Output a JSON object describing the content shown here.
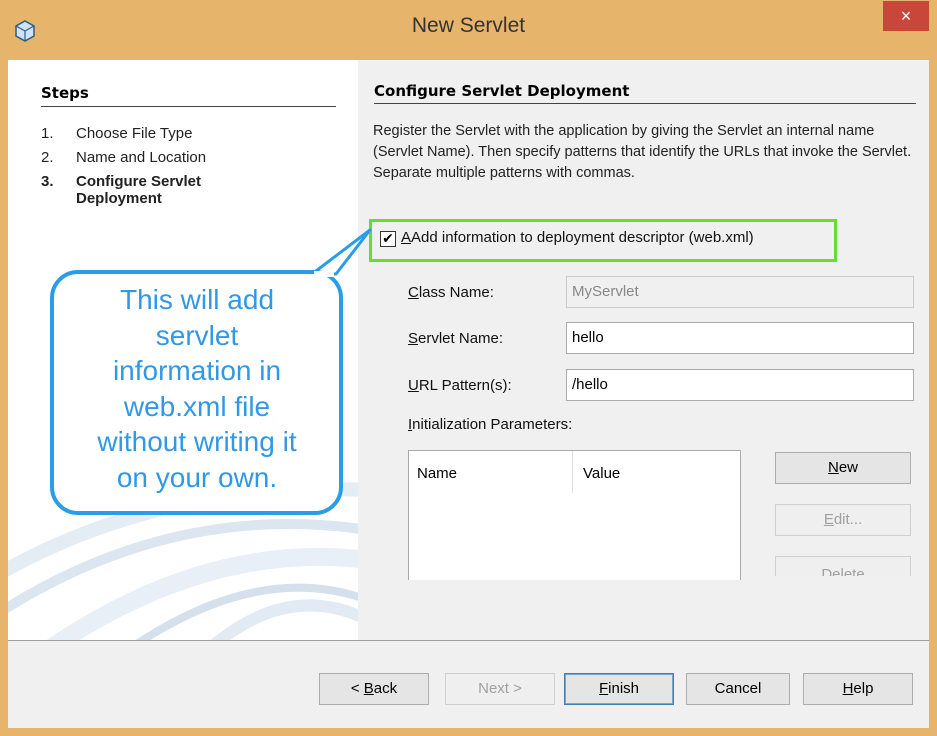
{
  "window": {
    "title": "New Servlet",
    "close_label": "×"
  },
  "steps": {
    "title": "Steps",
    "items": [
      {
        "num": "1.",
        "label": "Choose File Type"
      },
      {
        "num": "2.",
        "label": "Name and Location"
      },
      {
        "num": "3.",
        "label_line1": "Configure Servlet",
        "label_line2": "Deployment"
      }
    ]
  },
  "panel": {
    "title": "Configure Servlet Deployment",
    "description": "Register the Servlet with the application by giving the Servlet an internal name (Servlet Name). Then specify patterns that identify the URLs that invoke the Servlet. Separate multiple patterns with commas.",
    "checkbox": {
      "checked": true,
      "mark": "✔",
      "label": "Add information to deployment descriptor (web.xml)"
    },
    "class_name": {
      "label": "Class Name:",
      "value": "MyServlet"
    },
    "servlet_name": {
      "label_first": "S",
      "label_rest": "ervlet Name:",
      "value": "hello"
    },
    "url_pattern": {
      "label_first": "U",
      "label_rest": "RL Pattern(s):",
      "value": "/hello"
    },
    "init_params": {
      "label_first": "I",
      "label_rest": "nitialization Parameters:",
      "columns": [
        "Name",
        "Value"
      ]
    },
    "buttons": {
      "new": {
        "first": "N",
        "rest": "ew"
      },
      "edit": {
        "first": "E",
        "rest": "dit..."
      },
      "delete": {
        "label": "Delete"
      }
    }
  },
  "callout": {
    "lines": [
      "This will add",
      "servlet",
      "information in",
      "web.xml file",
      "without writing it",
      "on your own."
    ]
  },
  "footer": {
    "back": {
      "prefix": "< ",
      "first": "B",
      "rest": "ack"
    },
    "next": "Next >",
    "finish": {
      "first": "F",
      "rest": "inish"
    },
    "cancel": "Cancel",
    "help": {
      "first": "H",
      "rest": "elp"
    }
  },
  "colors": {
    "title_bar": "#e7b46b",
    "close": "#c9473a",
    "callout": "#2a9de8",
    "highlight": "#66dd33"
  }
}
